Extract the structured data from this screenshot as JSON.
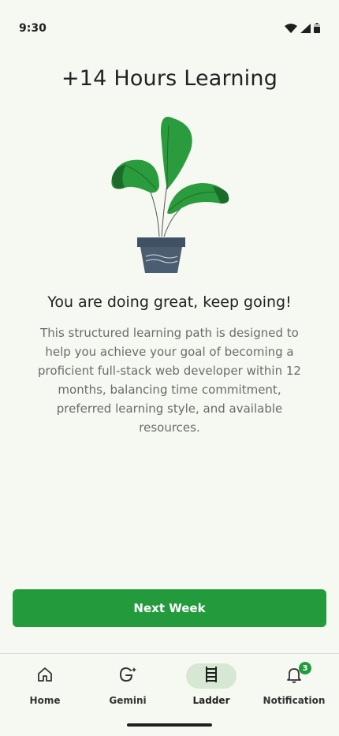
{
  "status_bar": {
    "time": "9:30",
    "icons": [
      "wifi-icon",
      "signal-icon",
      "battery-icon"
    ]
  },
  "main": {
    "title": "+14 Hours Learning",
    "illustration": "plant-in-pot",
    "subtitle": "You are doing great, keep going!",
    "description": "This structured learning path is designed to help you achieve your goal of becoming a proficient full-stack web developer within 12 months, balancing time commitment, preferred learning style, and available resources.",
    "primary_button": "Next Week"
  },
  "bottom_nav": {
    "items": [
      {
        "label": "Home",
        "icon": "home-icon",
        "active": false
      },
      {
        "label": "Gemini",
        "icon": "gemini-icon",
        "active": false
      },
      {
        "label": "Ladder",
        "icon": "ladder-icon",
        "active": true
      },
      {
        "label": "Notification",
        "icon": "bell-icon",
        "active": false,
        "badge": "3"
      }
    ]
  },
  "colors": {
    "background": "#f6f9f1",
    "accent": "#239b3c",
    "active_pill": "#d6e7d3",
    "text_muted": "#6b6b6b"
  }
}
